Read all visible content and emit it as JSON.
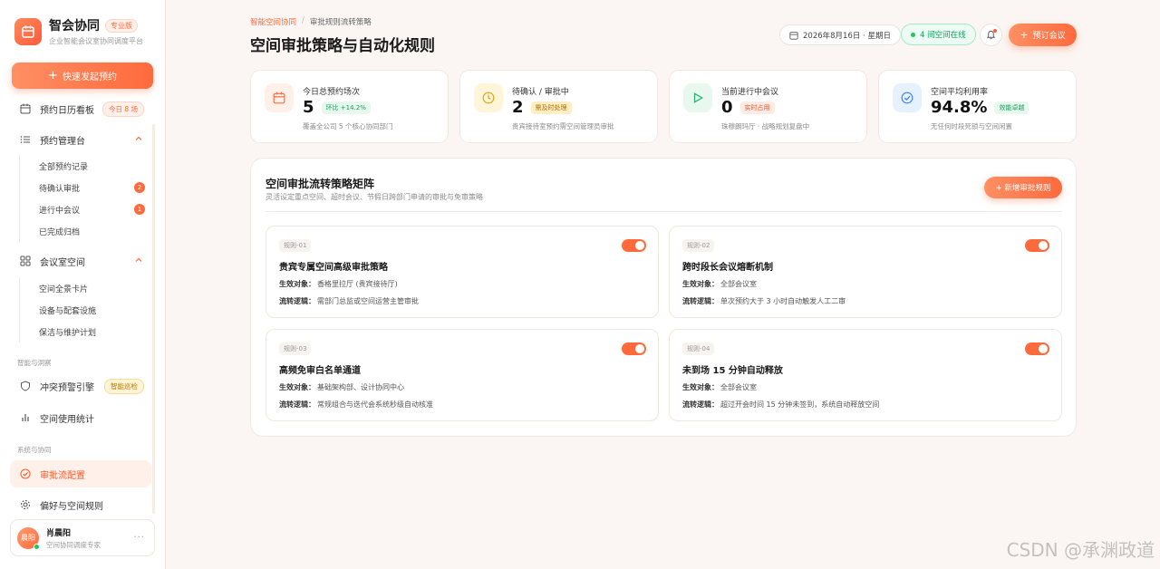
{
  "brand": {
    "name": "智会协同",
    "badge": "专业版",
    "subtitle": "企业智能会议室协同调度平台"
  },
  "sidebar": {
    "quick_button": "快速发起预约",
    "calendar": {
      "label": "预约日历看板",
      "badge": "今日 8 场"
    },
    "booking": {
      "label": "预约管理台",
      "items": [
        {
          "label": "全部预约记录"
        },
        {
          "label": "待确认审批",
          "count": "2"
        },
        {
          "label": "进行中会议",
          "count": "1"
        },
        {
          "label": "已完成归档"
        }
      ]
    },
    "rooms": {
      "label": "会议室空间",
      "items": [
        {
          "label": "空间全景卡片"
        },
        {
          "label": "设备与配套设施"
        },
        {
          "label": "保洁与维护计划"
        }
      ]
    },
    "section_insight": "智能与洞察",
    "conflict": {
      "label": "冲突预警引擎",
      "badge": "智能巡检"
    },
    "stats": {
      "label": "空间使用统计"
    },
    "section_system": "系统与协同",
    "approval": {
      "label": "审批流配置"
    },
    "prefs": {
      "label": "偏好与空间规则"
    },
    "user": {
      "avatar": "晨阳",
      "name": "肖晨阳",
      "role": "空间协同调度专家"
    }
  },
  "header": {
    "breadcrumb": [
      "智能空间协同",
      "审批规则流转策略"
    ],
    "title": "空间审批策略与自动化规则",
    "date": "2026年8月16日 · 星期日",
    "online": "4 间空间在线",
    "book_button": "预订会议"
  },
  "stats": [
    {
      "label": "今日总预约场次",
      "value": "5",
      "badge": "环比 +14.2%",
      "note": "覆盖全公司 5 个核心协同部门",
      "icon": "calendar-icon",
      "color": "#ff6a3d"
    },
    {
      "label": "待确认 / 审批中",
      "value": "2",
      "badge": "需及时处理",
      "note": "贵宾接待室预约需空间管理员审批",
      "icon": "clock-icon",
      "color": "#e0a21a"
    },
    {
      "label": "当前进行中会议",
      "value": "0",
      "badge": "实时占用",
      "note": "珠穆朗玛厅 · 战略规划复盘中",
      "icon": "play-icon",
      "color": "#22b573"
    },
    {
      "label": "空间平均利用率",
      "value": "94.8%",
      "badge": "效能卓越",
      "note": "无任何时段死锁与空间闲置",
      "icon": "check-circle-icon",
      "color": "#3b82f6"
    }
  ],
  "panel": {
    "title": "空间审批流转策略矩阵",
    "subtitle": "灵活设定重点空间、超时会议、节假日跨部门申请的审批与免审策略",
    "add_button": "+ 新增审批规则",
    "target_key": "生效对象：",
    "logic_key": "流转逻辑：",
    "rules": [
      {
        "id": "规则-01",
        "title": "贵宾专属空间高级审批策略",
        "target": "香格里拉厅 (贵宾接待厅)",
        "logic": "需部门总监或空间运营主管审批",
        "enabled": true
      },
      {
        "id": "规则-02",
        "title": "跨时段长会议熔断机制",
        "target": "全部会议室",
        "logic": "单次预约大于 3 小时自动触发人工二审",
        "enabled": true
      },
      {
        "id": "规则-03",
        "title": "高频免审白名单通道",
        "target": "基础架构部、设计协同中心",
        "logic": "常规组合与迭代会系统秒级自动核准",
        "enabled": true
      },
      {
        "id": "规则-04",
        "title": "未到场 15 分钟自动释放",
        "target": "全部会议室",
        "logic": "超过开会时间 15 分钟未签到，系统自动释放空间",
        "enabled": true
      }
    ]
  },
  "watermark": "CSDN @承渊政道"
}
